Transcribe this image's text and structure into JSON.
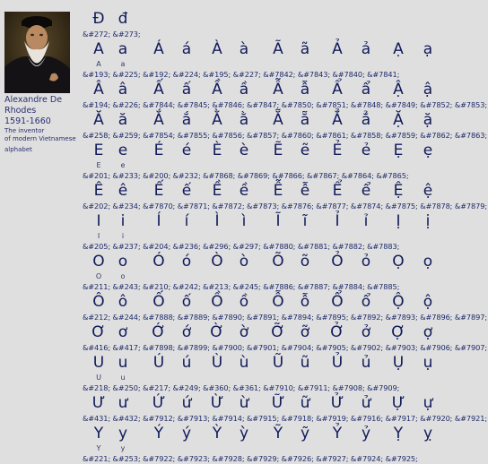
{
  "caption": {
    "name_line1": "Alexandre De",
    "name_line2": "Rhodes",
    "years": "1591-1660",
    "desc_line1": "The inventor",
    "desc_line2": "of modern Vietnamese",
    "desc_line3": "alphabet"
  },
  "rows": [
    {
      "glyphs": [
        "Đ",
        "đ"
      ],
      "small": [],
      "codes": "&#272; &#273;"
    },
    {
      "glyphs": [
        "A",
        "a",
        "Á",
        "á",
        "À",
        "à",
        "Ã",
        "ã",
        "Ả",
        "ả",
        "Ạ",
        "ạ"
      ],
      "small": [
        "A",
        "a"
      ],
      "codes": "&#193; &#225; &#192; &#224; &#195; &#227; &#7842; &#7843; &#7840; &#7841;"
    },
    {
      "glyphs": [
        "Â",
        "â",
        "Ấ",
        "ấ",
        "Ầ",
        "ầ",
        "Ẫ",
        "ẫ",
        "Ẩ",
        "ẩ",
        "Ậ",
        "ậ"
      ],
      "small": [],
      "codes": "&#194; &#226; &#7844; &#7845; &#7846; &#7847; &#7850; &#7851; &#7848; &#7849; &#7852; &#7853;"
    },
    {
      "glyphs": [
        "Ă",
        "ă",
        "Ắ",
        "ắ",
        "Ằ",
        "ằ",
        "Ẵ",
        "ẵ",
        "Ẳ",
        "ẳ",
        "Ặ",
        "ặ"
      ],
      "small": [],
      "codes": "&#258; &#259; &#7854; &#7855; &#7856; &#7857; &#7860; &#7861; &#7858; &#7859; &#7862; &#7863;"
    },
    {
      "glyphs": [
        "E",
        "e",
        "É",
        "é",
        "È",
        "è",
        "Ẽ",
        "ẽ",
        "Ẻ",
        "ẻ",
        "Ẹ",
        "ẹ"
      ],
      "small": [
        "E",
        "e"
      ],
      "codes": "&#201; &#233; &#200; &#232; &#7868; &#7869; &#7866; &#7867; &#7864; &#7865;"
    },
    {
      "glyphs": [
        "Ê",
        "ê",
        "Ế",
        "ế",
        "Ề",
        "ề",
        "Ễ",
        "ễ",
        "Ể",
        "ể",
        "Ệ",
        "ệ"
      ],
      "small": [],
      "codes": "&#202; &#234; &#7870; &#7871; &#7872; &#7873; &#7876; &#7877; &#7874; &#7875; &#7878; &#7879;"
    },
    {
      "glyphs": [
        "I",
        "i",
        "Í",
        "í",
        "Ì",
        "ì",
        "Ĩ",
        "ĩ",
        "Ỉ",
        "ỉ",
        "Ị",
        "ị"
      ],
      "small": [
        "I",
        "i"
      ],
      "codes": "&#205; &#237; &#204; &#236; &#296; &#297; &#7880; &#7881; &#7882; &#7883;"
    },
    {
      "glyphs": [
        "O",
        "o",
        "Ó",
        "ó",
        "Ò",
        "ò",
        "Õ",
        "õ",
        "Ỏ",
        "ỏ",
        "Ọ",
        "ọ"
      ],
      "small": [
        "O",
        "o"
      ],
      "codes": "&#211; &#243; &#210; &#242; &#213; &#245; &#7886; &#7887; &#7884; &#7885;"
    },
    {
      "glyphs": [
        "Ô",
        "ô",
        "Ố",
        "ố",
        "Ồ",
        "ồ",
        "Ỗ",
        "ỗ",
        "Ổ",
        "ổ",
        "Ộ",
        "ộ"
      ],
      "small": [],
      "codes": "&#212; &#244; &#7888; &#7889; &#7890; &#7891; &#7894; &#7895; &#7892; &#7893; &#7896; &#7897;"
    },
    {
      "glyphs": [
        "Ơ",
        "ơ",
        "Ớ",
        "ớ",
        "Ờ",
        "ờ",
        "Ỡ",
        "ỡ",
        "Ở",
        "ở",
        "Ợ",
        "ợ"
      ],
      "small": [],
      "codes": "&#416; &#417; &#7898; &#7899; &#7900; &#7901; &#7904; &#7905; &#7902; &#7903; &#7906; &#7907;"
    },
    {
      "glyphs": [
        "U",
        "u",
        "Ú",
        "ú",
        "Ù",
        "ù",
        "Ũ",
        "ũ",
        "Ủ",
        "ủ",
        "Ụ",
        "ụ"
      ],
      "small": [
        "U",
        "u"
      ],
      "codes": "&#218; &#250; &#217; &#249; &#360; &#361; &#7910; &#7911; &#7908; &#7909;"
    },
    {
      "glyphs": [
        "Ư",
        "ư",
        "Ứ",
        "ứ",
        "Ừ",
        "ừ",
        "Ữ",
        "ữ",
        "Ử",
        "ử",
        "Ự",
        "ự"
      ],
      "small": [],
      "codes": "&#431; &#432; &#7912; &#7913; &#7914; &#7915; &#7918; &#7919; &#7916; &#7917; &#7920; &#7921;"
    },
    {
      "glyphs": [
        "Y",
        "y",
        "Ý",
        "ý",
        "Ỳ",
        "ỳ",
        "Ỹ",
        "ỹ",
        "Ỷ",
        "ỷ",
        "Ỵ",
        "ỵ"
      ],
      "small": [
        "Y",
        "y"
      ],
      "codes": "&#221; &#253; &#7922; &#7923; &#7928; &#7929; &#7926; &#7927; &#7924; &#7925;"
    }
  ]
}
